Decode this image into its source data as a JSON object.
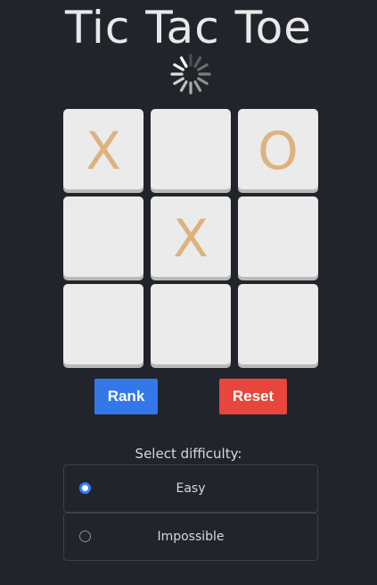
{
  "header": {
    "title": "Tic Tac Toe"
  },
  "status": {
    "spinner_icon": "loading-spinner-icon"
  },
  "board": {
    "cells": [
      "X",
      "",
      "O",
      "",
      "X",
      "",
      "",
      "",
      ""
    ]
  },
  "controls": {
    "rank_label": "Rank",
    "reset_label": "Reset"
  },
  "difficulty": {
    "label": "Select difficulty:",
    "options": [
      {
        "label": "Easy",
        "selected": true
      },
      {
        "label": "Impossible",
        "selected": false
      }
    ]
  },
  "colors": {
    "background": "#21242b",
    "cell": "#ebebeb",
    "mark": "#ddb27f",
    "rank_button": "#3377e8",
    "reset_button": "#e8453c",
    "radio_accent": "#2f7ef7"
  }
}
